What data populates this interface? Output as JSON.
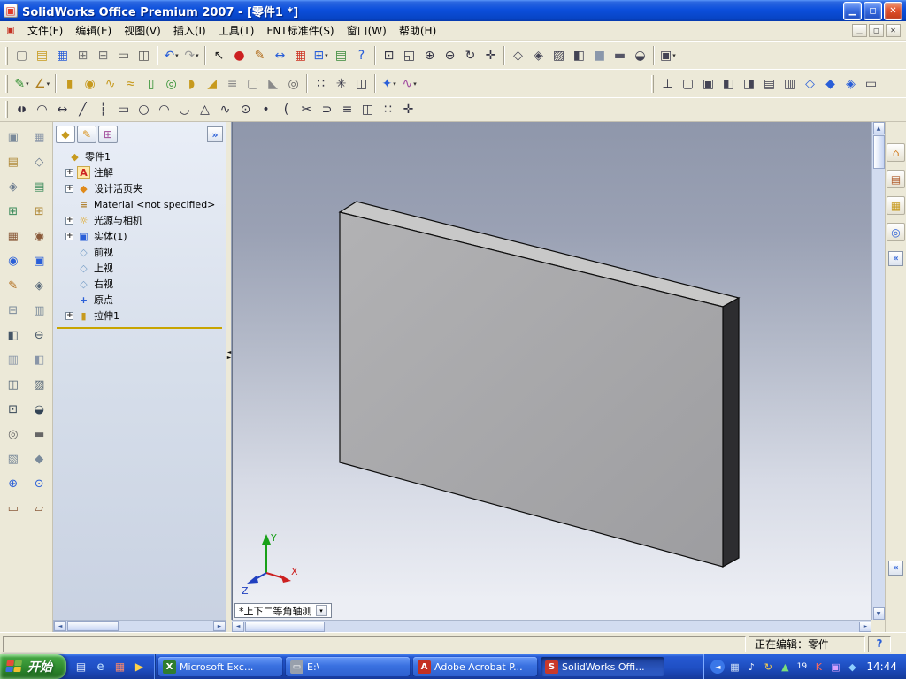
{
  "glyphs": {
    "dropdown": "▾",
    "expand": "+",
    "chev_right": "»",
    "chev_left": "«",
    "up": "▲",
    "down": "▼",
    "left": "◄",
    "right": "►",
    "min": "▁",
    "restore": "◻",
    "close": "✕",
    "grip_l": "◄",
    "grip_r": "►"
  },
  "window": {
    "title": "SolidWorks Office Premium 2007 - [零件1 *]",
    "app_icon_glyph": "▣"
  },
  "menu": {
    "items": [
      "文件(F)",
      "编辑(E)",
      "视图(V)",
      "插入(I)",
      "工具(T)",
      "FNT标准件(S)",
      "窗口(W)",
      "帮助(H)"
    ],
    "child_icon_glyph": "▣"
  },
  "toolbars": {
    "standard": [
      {
        "n": "new-document-button",
        "g": "▢",
        "c": "#777"
      },
      {
        "n": "open-document-button",
        "g": "▤",
        "c": "#c79a1e"
      },
      {
        "n": "save-button",
        "g": "▦",
        "c": "#2a5fd8"
      },
      {
        "n": "make-drawing-from-part-button",
        "g": "⊞",
        "c": "#777"
      },
      {
        "n": "make-assembly-from-part-button",
        "g": "⊟",
        "c": "#777"
      },
      {
        "n": "print-button",
        "g": "▭",
        "c": "#555"
      },
      {
        "n": "print-preview-button",
        "g": "◫",
        "c": "#555"
      },
      {
        "sep": true
      },
      {
        "n": "undo-button",
        "g": "↶",
        "c": "#2a5fd8",
        "dd": 1
      },
      {
        "n": "redo-button",
        "g": "↷",
        "c": "#999",
        "dd": 1
      },
      {
        "sep": true
      },
      {
        "n": "select-tool-button",
        "g": "↖",
        "c": "#222"
      },
      {
        "n": "record-macro-button",
        "g": "●",
        "c": "#cc2020"
      },
      {
        "n": "sketch-toggle-button",
        "g": "✎",
        "c": "#b06a18"
      },
      {
        "n": "dimension-button",
        "g": "↔",
        "c": "#2a5fd8"
      },
      {
        "n": "toolbox-button",
        "g": "▦",
        "c": "#cc3322"
      },
      {
        "n": "grid-button",
        "g": "⊞",
        "c": "#2a5fd8",
        "dd": 1
      },
      {
        "n": "options-button",
        "g": "▤",
        "c": "#3a8a3a"
      },
      {
        "n": "help-button",
        "g": "?",
        "c": "#2a5fd8"
      },
      {
        "sep": true
      },
      {
        "n": "zoom-to-fit-button",
        "g": "⊡",
        "c": "#334"
      },
      {
        "n": "zoom-to-area-button",
        "g": "◱",
        "c": "#334"
      },
      {
        "n": "zoom-in-out-button",
        "g": "⊕",
        "c": "#334"
      },
      {
        "n": "zoom-out-button",
        "g": "⊖",
        "c": "#334"
      },
      {
        "n": "rotate-view-button",
        "g": "↻",
        "c": "#334"
      },
      {
        "n": "pan-button",
        "g": "✛",
        "c": "#334"
      },
      {
        "sep": true
      },
      {
        "n": "wireframe-button",
        "g": "◇",
        "c": "#445"
      },
      {
        "n": "hidden-lines-visible-button",
        "g": "◈",
        "c": "#445"
      },
      {
        "n": "hidden-lines-removed-button",
        "g": "▨",
        "c": "#445"
      },
      {
        "n": "shaded-with-edges-button",
        "g": "◧",
        "c": "#445"
      },
      {
        "n": "shaded-button",
        "g": "■",
        "c": "#8a97ab"
      },
      {
        "n": "shadows-button",
        "g": "▬",
        "c": "#556"
      },
      {
        "n": "section-view-button",
        "g": "◒",
        "c": "#445"
      },
      {
        "sep": true
      },
      {
        "n": "view-orientation-button",
        "g": "▣",
        "c": "#445",
        "dd": 1
      }
    ],
    "features_left": [
      {
        "n": "sketch-flyout-button",
        "g": "✎",
        "c": "#2f8f2f",
        "dd": 1
      },
      {
        "n": "smart-dimension-flyout-button",
        "g": "∠",
        "c": "#b08020",
        "dd": 1
      },
      {
        "sep": true
      },
      {
        "n": "extruded-boss-button",
        "g": "▮",
        "c": "#c79a1e"
      },
      {
        "n": "revolved-boss-button",
        "g": "◉",
        "c": "#c79a1e"
      },
      {
        "n": "swept-boss-button",
        "g": "∿",
        "c": "#c79a1e"
      },
      {
        "n": "lofted-boss-button",
        "g": "≈",
        "c": "#c79a1e"
      },
      {
        "n": "extruded-cut-button",
        "g": "▯",
        "c": "#2f8f2f"
      },
      {
        "n": "revolved-cut-button",
        "g": "◎",
        "c": "#2f8f2f"
      },
      {
        "n": "fillet-button",
        "g": "◗",
        "c": "#c79a1e"
      },
      {
        "n": "chamfer-button",
        "g": "◢",
        "c": "#c79a1e"
      },
      {
        "n": "rib-button",
        "g": "≡",
        "c": "#8a8a8a"
      },
      {
        "n": "shell-button",
        "g": "▢",
        "c": "#8a8a8a"
      },
      {
        "n": "draft-button",
        "g": "◣",
        "c": "#8a8a8a"
      },
      {
        "n": "hole-wizard-button",
        "g": "◎",
        "c": "#666"
      },
      {
        "sep": true
      },
      {
        "n": "linear-pattern-button",
        "g": "∷",
        "c": "#334"
      },
      {
        "n": "circular-pattern-button",
        "g": "✳",
        "c": "#334"
      },
      {
        "n": "mirror-button",
        "g": "◫",
        "c": "#334"
      },
      {
        "sep": true
      },
      {
        "n": "reference-geometry-button",
        "g": "✦",
        "c": "#2a5fd8",
        "dd": 1
      },
      {
        "n": "curves-button",
        "g": "∿",
        "c": "#a04aa0",
        "dd": 1
      }
    ],
    "features_right": [
      {
        "n": "normal-to-view-button",
        "g": "⊥",
        "c": "#334"
      },
      {
        "n": "front-view-button",
        "g": "▢",
        "c": "#445"
      },
      {
        "n": "back-view-button",
        "g": "▣",
        "c": "#445"
      },
      {
        "n": "left-view-button",
        "g": "◧",
        "c": "#445"
      },
      {
        "n": "right-view-button",
        "g": "◨",
        "c": "#445"
      },
      {
        "n": "top-view-button",
        "g": "▤",
        "c": "#445"
      },
      {
        "n": "bottom-view-button",
        "g": "▥",
        "c": "#445"
      },
      {
        "n": "isometric-view-button",
        "g": "◇",
        "c": "#2a5fd8"
      },
      {
        "n": "trimetric-view-button",
        "g": "◆",
        "c": "#2a5fd8"
      },
      {
        "n": "dimetric-view-button",
        "g": "◈",
        "c": "#2a5fd8"
      },
      {
        "n": "view-selector-button",
        "g": "▭",
        "c": "#445"
      }
    ],
    "sketch": [
      {
        "n": "straight-slot-button",
        "g": "◖◗",
        "c": "#334",
        "fs": 9
      },
      {
        "n": "arc-slot-button",
        "g": "◠",
        "c": "#334"
      },
      {
        "n": "smart-dimension-button",
        "g": "↔",
        "c": "#334"
      },
      {
        "n": "line-button",
        "g": "╱",
        "c": "#334"
      },
      {
        "n": "centerline-button",
        "g": "┆",
        "c": "#334"
      },
      {
        "n": "corner-rectangle-button",
        "g": "▭",
        "c": "#334"
      },
      {
        "n": "circle-button",
        "g": "○",
        "c": "#334"
      },
      {
        "n": "centerpoint-arc-button",
        "g": "◠",
        "c": "#334"
      },
      {
        "n": "tangent-arc-button",
        "g": "◡",
        "c": "#334"
      },
      {
        "n": "polygon-button",
        "g": "△",
        "c": "#334"
      },
      {
        "n": "spline-button",
        "g": "∿",
        "c": "#334"
      },
      {
        "n": "ellipse-button",
        "g": "⊙",
        "c": "#334"
      },
      {
        "n": "point-button",
        "g": "•",
        "c": "#334"
      },
      {
        "n": "sketch-fillet-button",
        "g": "(",
        "c": "#334"
      },
      {
        "n": "trim-entities-button",
        "g": "✂",
        "c": "#334"
      },
      {
        "n": "convert-entities-button",
        "g": "⊃",
        "c": "#334"
      },
      {
        "n": "offset-entities-button",
        "g": "≡",
        "c": "#334"
      },
      {
        "n": "mirror-entities-button",
        "g": "◫",
        "c": "#334"
      },
      {
        "n": "linear-sketch-pattern-button",
        "g": "∷",
        "c": "#334"
      },
      {
        "n": "move-entities-button",
        "g": "✛",
        "c": "#334"
      }
    ]
  },
  "left_strip": {
    "col1": [
      {
        "n": "docked-tool-button-1",
        "g": "▣",
        "c": "#7a8a9a"
      },
      {
        "n": "docked-tool-button-2",
        "g": "▤",
        "c": "#b08a3a"
      },
      {
        "n": "docked-tool-button-3",
        "g": "◈",
        "c": "#6a7a8e"
      },
      {
        "n": "docked-tool-button-4",
        "g": "⊞",
        "c": "#3a8a5a"
      },
      {
        "n": "docked-tool-button-5",
        "g": "▦",
        "c": "#8a5a3a"
      },
      {
        "n": "docked-tool-button-6",
        "g": "◉",
        "c": "#2a5fd8"
      },
      {
        "n": "docked-tool-button-7",
        "g": "✎",
        "c": "#b06a18"
      },
      {
        "n": "docked-tool-button-8",
        "g": "⊟",
        "c": "#7a8a9a"
      },
      {
        "n": "docked-tool-button-9",
        "g": "◧",
        "c": "#445566"
      },
      {
        "n": "docked-tool-button-10",
        "g": "▥",
        "c": "#8a96a8"
      },
      {
        "n": "docked-tool-button-11",
        "g": "◫",
        "c": "#556677"
      },
      {
        "n": "docked-tool-button-12",
        "g": "⊡",
        "c": "#334455"
      },
      {
        "n": "docked-tool-button-13",
        "g": "◎",
        "c": "#666"
      },
      {
        "n": "docked-tool-button-14",
        "g": "▧",
        "c": "#7a8a9a"
      },
      {
        "n": "docked-tool-button-15",
        "g": "⊕",
        "c": "#2a5fd8"
      },
      {
        "n": "docked-tool-button-16",
        "g": "▭",
        "c": "#8a5a3a"
      }
    ],
    "col2": [
      {
        "n": "docked-tool-button-17",
        "g": "▦",
        "c": "#8a96a8"
      },
      {
        "n": "docked-tool-button-18",
        "g": "◇",
        "c": "#6a7a8e"
      },
      {
        "n": "docked-tool-button-19",
        "g": "▤",
        "c": "#3a8a5a"
      },
      {
        "n": "docked-tool-button-20",
        "g": "⊞",
        "c": "#b08a3a"
      },
      {
        "n": "docked-tool-button-21",
        "g": "◉",
        "c": "#8a5a3a"
      },
      {
        "n": "docked-tool-button-22",
        "g": "▣",
        "c": "#2a5fd8"
      },
      {
        "n": "docked-tool-button-23",
        "g": "◈",
        "c": "#556677"
      },
      {
        "n": "docked-tool-button-24",
        "g": "▥",
        "c": "#7a8a9a"
      },
      {
        "n": "docked-tool-button-25",
        "g": "⊖",
        "c": "#445566"
      },
      {
        "n": "docked-tool-button-26",
        "g": "◧",
        "c": "#8a96a8"
      },
      {
        "n": "docked-tool-button-27",
        "g": "▨",
        "c": "#556677"
      },
      {
        "n": "docked-tool-button-28",
        "g": "◒",
        "c": "#334455"
      },
      {
        "n": "docked-tool-button-29",
        "g": "▬",
        "c": "#666"
      },
      {
        "n": "docked-tool-button-30",
        "g": "◆",
        "c": "#7a8a9a"
      },
      {
        "n": "docked-tool-button-31",
        "g": "⊙",
        "c": "#2a5fd8"
      },
      {
        "n": "docked-tool-button-32",
        "g": "▱",
        "c": "#8a5a3a"
      }
    ]
  },
  "feature_tree": {
    "tabs": [
      {
        "n": "featuremanager-tab",
        "g": "◆",
        "c": "#c79a1e",
        "cls": "active"
      },
      {
        "n": "propertymanager-tab",
        "g": "✎",
        "c": "#d8901a"
      },
      {
        "n": "configurationmanager-tab",
        "g": "⊞",
        "c": "#a04a9a"
      }
    ],
    "root": {
      "label": "零件1",
      "icon": "part-icon",
      "g": "◆",
      "c": "#c79a1e"
    },
    "items": [
      {
        "label": "注解",
        "icon": "annotations-icon",
        "g": "A",
        "c": "#cc2222",
        "bg": "#ffe9a8",
        "expand": true
      },
      {
        "label": "设计活页夹",
        "icon": "design-binder-icon",
        "g": "◆",
        "c": "#e08a1a",
        "expand": true
      },
      {
        "label": "Material <not specified>",
        "icon": "material-icon",
        "g": "≡",
        "c": "#b08030",
        "expand": false
      },
      {
        "label": "光源与相机",
        "icon": "lights-cameras-icon",
        "g": "☼",
        "c": "#e0a010",
        "expand": true
      },
      {
        "label": "实体(1)",
        "icon": "solid-bodies-folder-icon",
        "g": "▣",
        "c": "#2a5fd8",
        "expand": true
      },
      {
        "label": "前视",
        "icon": "front-plane-icon",
        "g": "◇",
        "c": "#7aa0c8",
        "expand": false
      },
      {
        "label": "上视",
        "icon": "top-plane-icon",
        "g": "◇",
        "c": "#7aa0c8",
        "expand": false
      },
      {
        "label": "右视",
        "icon": "right-plane-icon",
        "g": "◇",
        "c": "#7aa0c8",
        "expand": false
      },
      {
        "label": "原点",
        "icon": "origin-icon",
        "g": "+",
        "c": "#2a5fd8",
        "expand": false
      },
      {
        "label": "拉伸1",
        "icon": "extrude-feature-icon",
        "g": "▮",
        "c": "#c79a1e",
        "expand": true
      }
    ]
  },
  "task_pane": {
    "icons": [
      {
        "n": "solidworks-resources-tab",
        "g": "⌂",
        "c": "#d07818"
      },
      {
        "n": "design-library-tab",
        "g": "▤",
        "c": "#b05a2a"
      },
      {
        "n": "file-explorer-tab",
        "g": "▦",
        "c": "#c79a1e"
      },
      {
        "n": "search-tab",
        "g": "◎",
        "c": "#2a5fd8"
      }
    ]
  },
  "viewport": {
    "view_label": "*上下二等角轴测",
    "triad": {
      "x": "X",
      "y": "Y",
      "z": "Z"
    },
    "part_colors": {
      "top": "#c8c8c8",
      "front_light": "#b2b2b4",
      "front_dark": "#a0a0a3",
      "side": "#2d2d30",
      "edge": "#0d0d0d"
    }
  },
  "status_bar": {
    "editing_label": "正在编辑：零件",
    "help_glyph": "?"
  },
  "taskbar": {
    "start_label": "开始",
    "quick_launch": [
      {
        "n": "show-desktop-icon",
        "g": "▤",
        "c": "#e8f0ff"
      },
      {
        "n": "internet-explorer-icon",
        "g": "e",
        "c": "#bfe0ff",
        "fs": 13
      },
      {
        "n": "quick-launch-app-icon",
        "g": "▦",
        "c": "#ff8a6a"
      },
      {
        "n": "media-player-icon",
        "g": "▶",
        "c": "#ffd24a"
      }
    ],
    "tasks": [
      {
        "name": "task-microsoft-excel",
        "icon": "excel-icon",
        "g": "X",
        "ic": "#2f7d2f",
        "label": "Microsoft Exc...",
        "active": false
      },
      {
        "name": "task-e-drive",
        "icon": "drive-icon",
        "g": "▭",
        "ic": "#98a0ac",
        "label": "E:\\",
        "active": false
      },
      {
        "name": "task-adobe-acrobat",
        "icon": "acrobat-icon",
        "g": "A",
        "ic": "#c43022",
        "label": "Adobe Acrobat P...",
        "active": false
      },
      {
        "name": "task-solidworks",
        "icon": "solidworks-icon",
        "g": "S",
        "ic": "#c8392a",
        "label": "SolidWorks Offi...",
        "active": true
      }
    ],
    "tray_icons": [
      {
        "n": "tray-hidden-icons-button",
        "g": "◄",
        "c": "#fff",
        "bg": "#3a77e8",
        "fs": 8
      },
      {
        "n": "tray-network-icon",
        "g": "▦",
        "c": "#cfe0f8"
      },
      {
        "n": "tray-volume-icon",
        "g": "♪",
        "c": "#fff"
      },
      {
        "n": "tray-update-icon",
        "g": "↻",
        "c": "#ffd24a"
      },
      {
        "n": "tray-antivirus-icon",
        "g": "▲",
        "c": "#7adf7a"
      },
      {
        "n": "tray-date-icon",
        "g": "19",
        "c": "#fff",
        "fs": 9
      },
      {
        "n": "tray-input-method-icon",
        "g": "K",
        "c": "#ff6a5a"
      },
      {
        "n": "tray-app-icon",
        "g": "▣",
        "c": "#d8a0ff"
      },
      {
        "n": "tray-messenger-icon",
        "g": "◆",
        "c": "#8fd0ff"
      }
    ],
    "time": "14:44"
  }
}
